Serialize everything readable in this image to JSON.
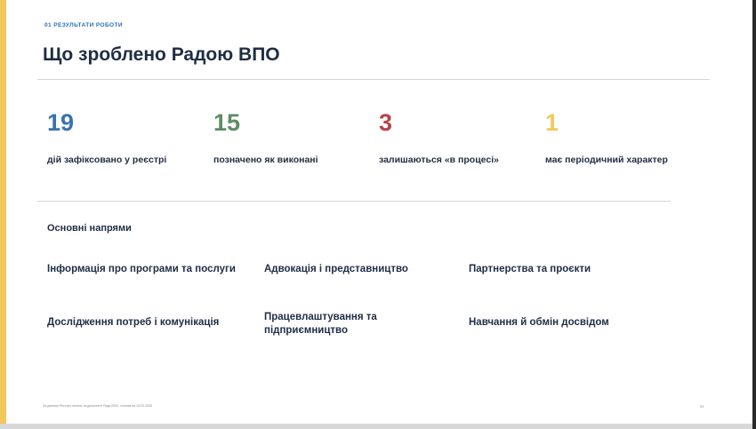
{
  "header": {
    "section_label": "01  РЕЗУЛЬТАТИ РОБОТИ",
    "title": "Що зроблено Радою ВПО"
  },
  "stats": [
    {
      "value": "19",
      "caption": "дій зафіксовано у реєстрі",
      "color": "#3a73ad"
    },
    {
      "value": "15",
      "caption": "позначено як виконані",
      "color": "#5e8b63"
    },
    {
      "value": "3",
      "caption": "залишаються «в процесі»",
      "color": "#b8434a"
    },
    {
      "value": "1",
      "caption": "має періодичний характер",
      "color": "#f3c85b"
    }
  ],
  "directions": {
    "heading": "Основні напрями",
    "items": [
      "Інформація про програми та послуги",
      "Адвокація і представництво",
      "Партнерства та проєкти",
      "Дослідження потреб і комунікація",
      "Працевлаштування та підприємництво",
      "Навчання й обмін досвідом"
    ]
  },
  "footer": {
    "note": "За даними Реєстру питань та діяльності Ради ВПО, станом на 15.03.2026",
    "page_number": "05"
  },
  "colors": {
    "accent_bar": "#f3c85b",
    "title": "#1f2d44",
    "section_label": "#2c6eb5"
  }
}
